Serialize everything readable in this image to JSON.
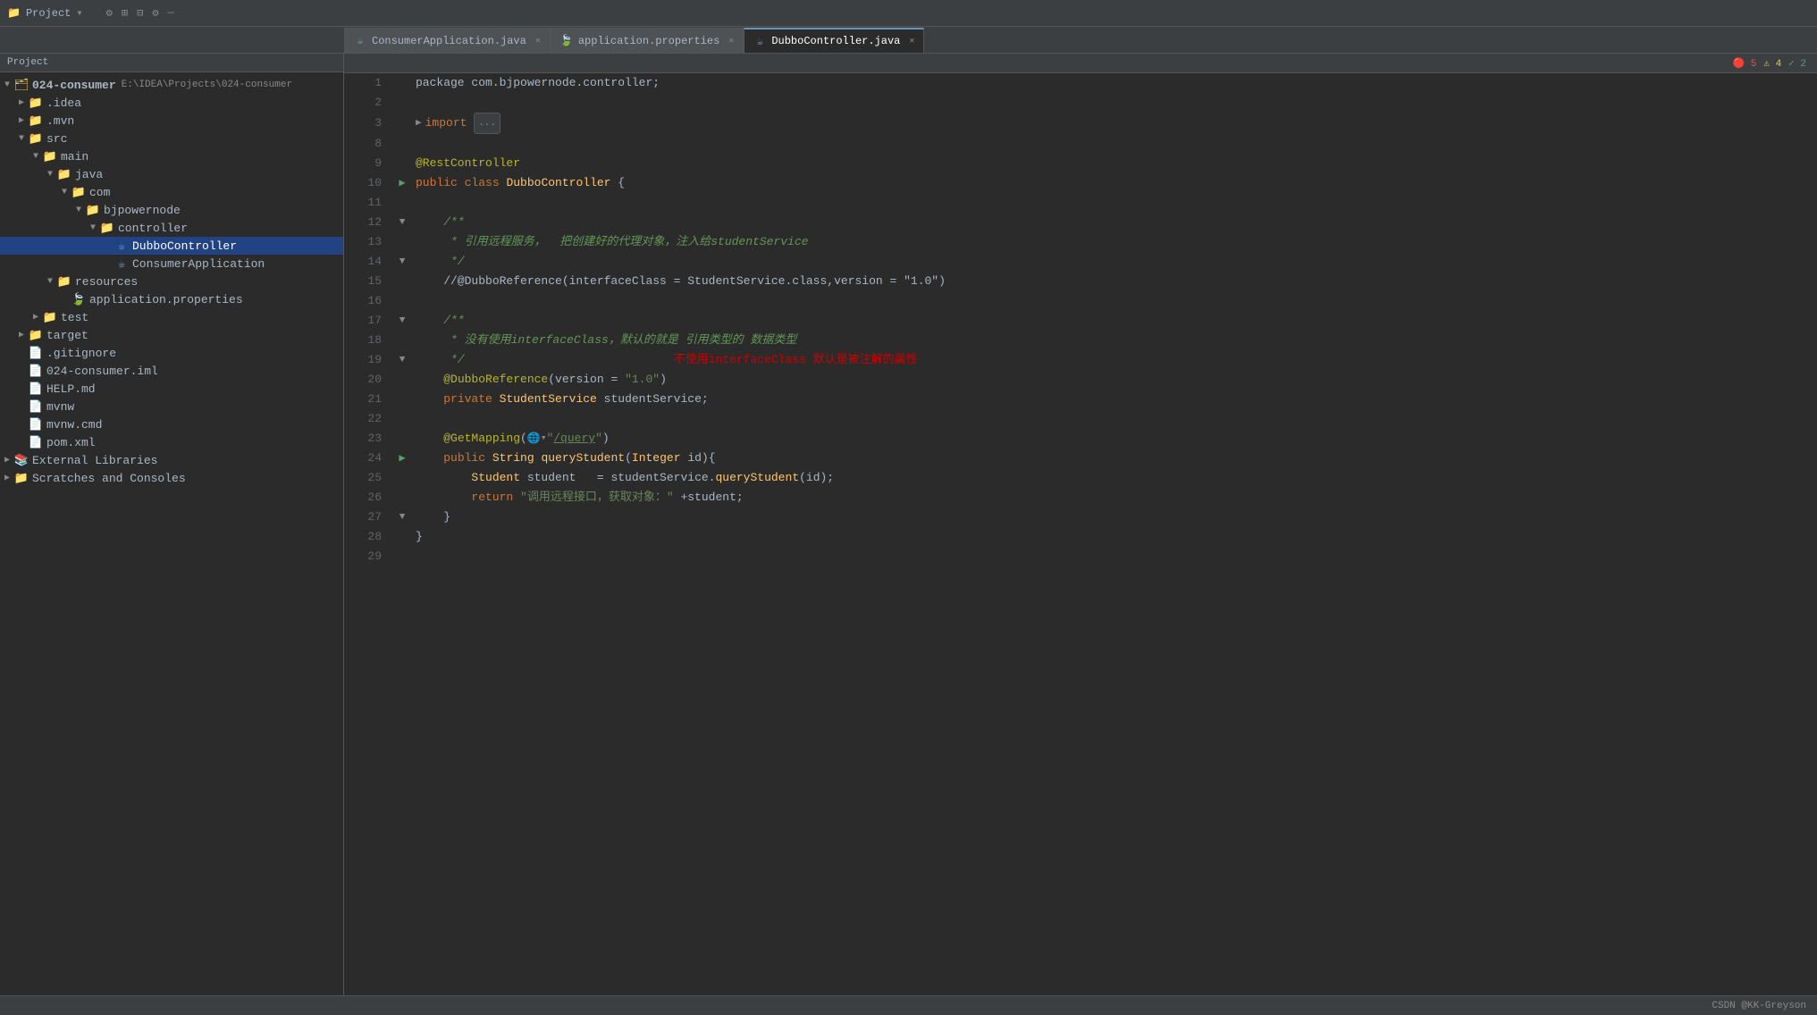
{
  "titleBar": {
    "projectLabel": "Project",
    "dropdownIcon": "▾"
  },
  "tabs": [
    {
      "id": "consumer",
      "label": "ConsumerApplication.java",
      "icon": "java",
      "active": false,
      "closable": true
    },
    {
      "id": "properties",
      "label": "application.properties",
      "icon": "properties",
      "active": false,
      "closable": true
    },
    {
      "id": "dubbo",
      "label": "DubboController.java",
      "icon": "java",
      "active": true,
      "closable": true
    }
  ],
  "statusBar": {
    "errors": "🔴 5",
    "warnings": "⚠ 4",
    "ok": "✓ 2"
  },
  "sidebar": {
    "title": "Project",
    "items": [
      {
        "id": "root",
        "label": "024-consumer",
        "sublabel": "E:\\IDEA\\Projects\\024-consumer",
        "indent": 0,
        "expanded": true,
        "type": "project"
      },
      {
        "id": "idea",
        "label": ".idea",
        "indent": 1,
        "expanded": false,
        "type": "folder"
      },
      {
        "id": "mvn",
        "label": ".mvn",
        "indent": 1,
        "expanded": false,
        "type": "folder"
      },
      {
        "id": "src",
        "label": "src",
        "indent": 1,
        "expanded": true,
        "type": "folder-src"
      },
      {
        "id": "main",
        "label": "main",
        "indent": 2,
        "expanded": true,
        "type": "folder"
      },
      {
        "id": "java",
        "label": "java",
        "indent": 3,
        "expanded": true,
        "type": "folder-blue"
      },
      {
        "id": "com",
        "label": "com",
        "indent": 4,
        "expanded": true,
        "type": "folder"
      },
      {
        "id": "bjpowernode",
        "label": "bjpowernode",
        "indent": 5,
        "expanded": true,
        "type": "folder"
      },
      {
        "id": "controller",
        "label": "controller",
        "indent": 6,
        "expanded": true,
        "type": "folder"
      },
      {
        "id": "dubbocontroller",
        "label": "DubboController",
        "indent": 7,
        "expanded": false,
        "type": "java",
        "selected": true
      },
      {
        "id": "consumerapplication",
        "label": "ConsumerApplication",
        "indent": 7,
        "expanded": false,
        "type": "java"
      },
      {
        "id": "resources",
        "label": "resources",
        "indent": 3,
        "expanded": true,
        "type": "folder"
      },
      {
        "id": "appprops",
        "label": "application.properties",
        "indent": 4,
        "expanded": false,
        "type": "properties"
      },
      {
        "id": "test",
        "label": "test",
        "indent": 2,
        "expanded": false,
        "type": "folder"
      },
      {
        "id": "target",
        "label": "target",
        "indent": 1,
        "expanded": false,
        "type": "folder"
      },
      {
        "id": "gitignore",
        "label": ".gitignore",
        "indent": 1,
        "type": "file"
      },
      {
        "id": "iml",
        "label": "024-consumer.iml",
        "indent": 1,
        "type": "file"
      },
      {
        "id": "help",
        "label": "HELP.md",
        "indent": 1,
        "type": "file"
      },
      {
        "id": "mvnw",
        "label": "mvnw",
        "indent": 1,
        "type": "file"
      },
      {
        "id": "mvnwcmd",
        "label": "mvnw.cmd",
        "indent": 1,
        "type": "file"
      },
      {
        "id": "pom",
        "label": "pom.xml",
        "indent": 1,
        "type": "file-xml"
      },
      {
        "id": "extlibs",
        "label": "External Libraries",
        "indent": 0,
        "expanded": false,
        "type": "folder"
      },
      {
        "id": "scratches",
        "label": "Scratches and Consoles",
        "indent": 0,
        "expanded": false,
        "type": "folder"
      }
    ]
  },
  "editor": {
    "filename": "DubboController.java",
    "lines": [
      {
        "num": 1,
        "tokens": [
          {
            "t": "plain",
            "v": "package com.bjpowernode.controller;"
          }
        ],
        "gutter": ""
      },
      {
        "num": 2,
        "tokens": [],
        "gutter": ""
      },
      {
        "num": 3,
        "tokens": [
          {
            "t": "fold",
            "v": "▶"
          },
          {
            "t": "kw",
            "v": "import"
          },
          {
            "t": "plain",
            "v": " "
          },
          {
            "t": "collapsed",
            "v": "..."
          }
        ],
        "gutter": ""
      },
      {
        "num": 8,
        "tokens": [],
        "gutter": ""
      },
      {
        "num": 9,
        "tokens": [
          {
            "t": "ann",
            "v": "@RestController"
          }
        ],
        "gutter": ""
      },
      {
        "num": 10,
        "tokens": [
          {
            "t": "kw",
            "v": "public"
          },
          {
            "t": "plain",
            "v": " "
          },
          {
            "t": "kw",
            "v": "class"
          },
          {
            "t": "plain",
            "v": " "
          },
          {
            "t": "cls",
            "v": "DubboController"
          },
          {
            "t": "plain",
            "v": " {"
          }
        ],
        "gutter": "run"
      },
      {
        "num": 11,
        "tokens": [],
        "gutter": ""
      },
      {
        "num": 12,
        "tokens": [
          {
            "t": "plain",
            "v": "    "
          },
          {
            "t": "fold",
            "v": "▼"
          },
          {
            "t": "cmt",
            "v": "/**"
          }
        ],
        "gutter": ""
      },
      {
        "num": 13,
        "tokens": [
          {
            "t": "cmt",
            "v": "     * 引用远程服务，  把创建好的代理对象，注入给studentService"
          }
        ],
        "gutter": ""
      },
      {
        "num": 14,
        "tokens": [
          {
            "t": "cmt",
            "v": "     */"
          }
        ],
        "gutter": ""
      },
      {
        "num": 15,
        "tokens": [
          {
            "t": "plain",
            "v": "    //"
          },
          {
            "t": "plain",
            "v": "@DubboReference(interfaceClass = StudentService.class,version = \"1.0\")"
          }
        ],
        "gutter": ""
      },
      {
        "num": 16,
        "tokens": [],
        "gutter": ""
      },
      {
        "num": 17,
        "tokens": [
          {
            "t": "plain",
            "v": "    "
          },
          {
            "t": "fold",
            "v": "▼"
          },
          {
            "t": "cmt",
            "v": "/**"
          }
        ],
        "gutter": ""
      },
      {
        "num": 18,
        "tokens": [
          {
            "t": "cmt",
            "v": "     * 没有使用interfaceClass，默认的就是 引用类型的 数据类型"
          }
        ],
        "gutter": ""
      },
      {
        "num": 19,
        "tokens": [
          {
            "t": "cmt",
            "v": "     */"
          },
          {
            "t": "plain",
            "v": "                              "
          },
          {
            "t": "cmt-red",
            "v": "不使用interfaceClass 默认是被注解的属性"
          }
        ],
        "gutter": ""
      },
      {
        "num": 20,
        "tokens": [
          {
            "t": "plain",
            "v": "    "
          },
          {
            "t": "ann",
            "v": "@DubboReference"
          },
          {
            "t": "plain",
            "v": "(version = "
          },
          {
            "t": "str",
            "v": "\"1.0\""
          },
          {
            "t": "plain",
            "v": ")"
          }
        ],
        "gutter": ""
      },
      {
        "num": 21,
        "tokens": [
          {
            "t": "plain",
            "v": "    "
          },
          {
            "t": "kw",
            "v": "private"
          },
          {
            "t": "plain",
            "v": " "
          },
          {
            "t": "cls",
            "v": "StudentService"
          },
          {
            "t": "plain",
            "v": " studentService;"
          }
        ],
        "gutter": ""
      },
      {
        "num": 22,
        "tokens": [],
        "gutter": ""
      },
      {
        "num": 23,
        "tokens": [
          {
            "t": "plain",
            "v": "    "
          },
          {
            "t": "ann",
            "v": "@GetMapping"
          },
          {
            "t": "plain",
            "v": "("
          },
          {
            "t": "globe",
            "v": "🌐"
          },
          {
            "t": "plain",
            "v": "▾"
          },
          {
            "t": "str",
            "v": "\"/query\""
          },
          {
            "t": "plain",
            "v": ")"
          }
        ],
        "gutter": ""
      },
      {
        "num": 24,
        "tokens": [
          {
            "t": "plain",
            "v": "    "
          },
          {
            "t": "kw",
            "v": "public"
          },
          {
            "t": "plain",
            "v": " "
          },
          {
            "t": "cls",
            "v": "String"
          },
          {
            "t": "plain",
            "v": " "
          },
          {
            "t": "method",
            "v": "queryStudent"
          },
          {
            "t": "plain",
            "v": "("
          },
          {
            "t": "cls",
            "v": "Integer"
          },
          {
            "t": "plain",
            "v": " id){"
          }
        ],
        "gutter": "run"
      },
      {
        "num": 25,
        "tokens": [
          {
            "t": "plain",
            "v": "        "
          },
          {
            "t": "cls",
            "v": "Student"
          },
          {
            "t": "plain",
            "v": " student   = studentService."
          },
          {
            "t": "method",
            "v": "queryStudent"
          },
          {
            "t": "plain",
            "v": "(id);"
          }
        ],
        "gutter": ""
      },
      {
        "num": 26,
        "tokens": [
          {
            "t": "plain",
            "v": "        "
          },
          {
            "t": "kw",
            "v": "return"
          },
          {
            "t": "plain",
            "v": " "
          },
          {
            "t": "str",
            "v": "\"调用远程接口，获取对象：\""
          },
          {
            "t": "plain",
            "v": " +student;"
          }
        ],
        "gutter": ""
      },
      {
        "num": 27,
        "tokens": [
          {
            "t": "plain",
            "v": "    }"
          }
        ],
        "gutter": "fold"
      },
      {
        "num": 28,
        "tokens": [
          {
            "t": "plain",
            "v": "}"
          }
        ],
        "gutter": ""
      },
      {
        "num": 29,
        "tokens": [],
        "gutter": ""
      }
    ]
  },
  "bottomBar": {
    "credit": "CSDN @KK-Greyson"
  }
}
